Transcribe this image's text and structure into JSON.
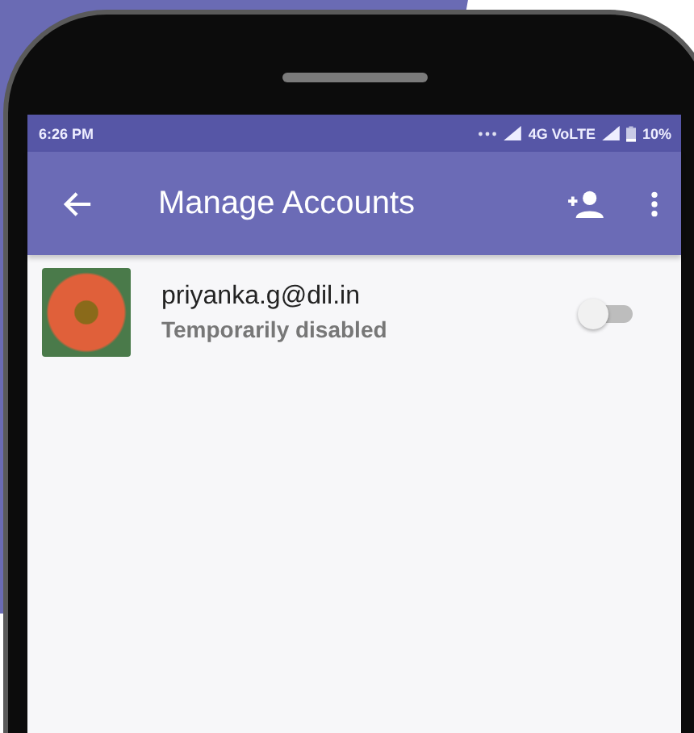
{
  "status_bar": {
    "time": "6:26 PM",
    "network": "4G VoLTE",
    "battery": "10%"
  },
  "app_bar": {
    "title": "Manage Accounts"
  },
  "accounts": [
    {
      "email": "priyanka.g@dil.in",
      "status": "Temporarily disabled",
      "enabled": false
    }
  ]
}
